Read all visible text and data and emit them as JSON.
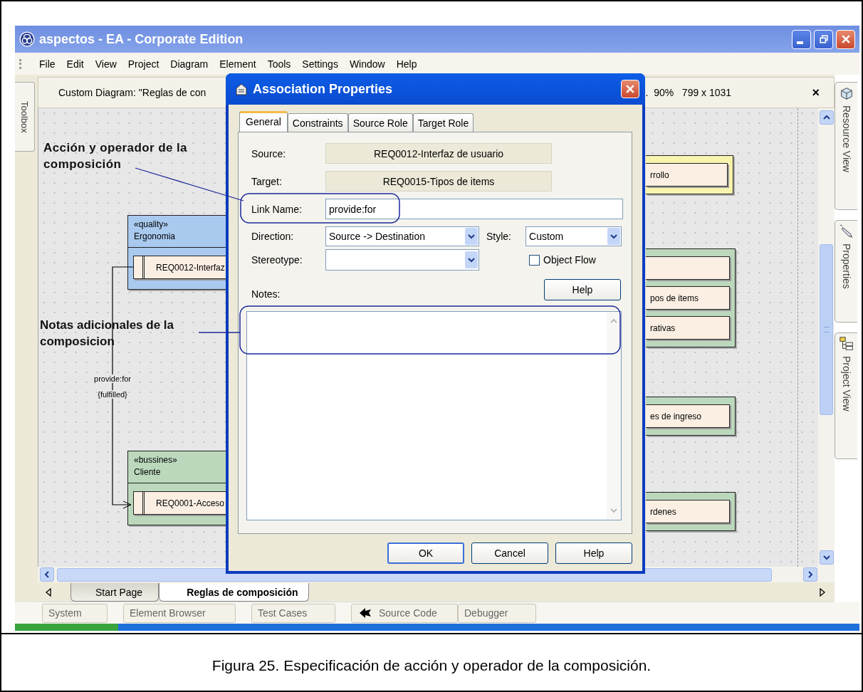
{
  "window": {
    "title": "aspectos - EA - Corporate Edition"
  },
  "menu": [
    "File",
    "Edit",
    "View",
    "Project",
    "Diagram",
    "Element",
    "Tools",
    "Settings",
    "Window",
    "Help"
  ],
  "toolbox": {
    "label": "Toolbox"
  },
  "diagram_header": {
    "title": "Custom Diagram: \"Reglas de con",
    "info": ".  90%   799 x 1031",
    "close": "×"
  },
  "diagram": {
    "packages": [
      {
        "stereotype": "«quality»",
        "name": "Ergonomia",
        "color": "#a9c9ef",
        "elements": [
          {
            "kind": "requirement",
            "label": "REQ0012-Interfaz"
          }
        ]
      },
      {
        "stereotype": "«bussines»",
        "name": "Cliente",
        "color": "#bcd8bc",
        "elements": [
          {
            "kind": "requirement",
            "label": "REQ0001-Acceso"
          }
        ]
      },
      {
        "color": "#f8f3ad",
        "elements": [
          {
            "kind": "requirement",
            "label": "rrollo"
          }
        ]
      },
      {
        "color": "#bcd8bc",
        "elements": [
          {
            "kind": "requirement"
          },
          {
            "kind": "requirement",
            "label": "pos de items"
          },
          {
            "kind": "requirement",
            "label": "rativas"
          }
        ]
      },
      {
        "color": "#bcd8bc",
        "elements": [
          {
            "kind": "requirement",
            "label": "es de ingreso"
          }
        ]
      },
      {
        "color": "#bcd8bc",
        "elements": [
          {
            "kind": "requirement",
            "label": "rdenes"
          }
        ]
      }
    ],
    "connector": {
      "name": "provide:for",
      "constraint": "{fulfilled}"
    },
    "callouts": [
      {
        "text": "Acción y operador de la composición"
      },
      {
        "text": "Notas adicionales de la composicion"
      }
    ]
  },
  "document_tabs": [
    {
      "label": "Start Page",
      "selected": false
    },
    {
      "label": "Reglas de composición",
      "selected": true
    }
  ],
  "side_tabs": [
    {
      "label": "Resource View"
    },
    {
      "label": "Properties"
    },
    {
      "label": "Project View"
    }
  ],
  "bottom_buttons": [
    {
      "label": "System",
      "kind": "plain"
    },
    {
      "label": "Element Browser",
      "kind": "plain"
    },
    {
      "label": "Test Cases",
      "kind": "plain"
    },
    {
      "label": "Source Code",
      "kind": "with_icon"
    },
    {
      "label": "Debugger",
      "kind": "plain"
    }
  ],
  "dialog": {
    "title": "Association Properties",
    "tabs": [
      {
        "label": "General",
        "selected": true
      },
      {
        "label": "Constraints",
        "selected": false
      },
      {
        "label": "Source Role",
        "selected": false
      },
      {
        "label": "Target Role",
        "selected": false
      }
    ],
    "source": {
      "label": "Source:",
      "value": "REQ0012-Interfaz de usuario"
    },
    "target": {
      "label": "Target:",
      "value": "REQ0015-Tipos de items"
    },
    "link_name": {
      "label": "Link Name:",
      "value": "provide:for"
    },
    "direction": {
      "label": "Direction:",
      "value": "Source -> Destination"
    },
    "style": {
      "label": "Style:",
      "value": "Custom"
    },
    "stereotype": {
      "label": "Stereotype:"
    },
    "object_flow": {
      "label": "Object Flow",
      "checked": false
    },
    "notes": {
      "label": "Notes:",
      "help": "Help"
    },
    "buttons": [
      "OK",
      "Cancel",
      "Help"
    ]
  },
  "caption": "Figura 25. Especificación de acción y operador de la composición."
}
